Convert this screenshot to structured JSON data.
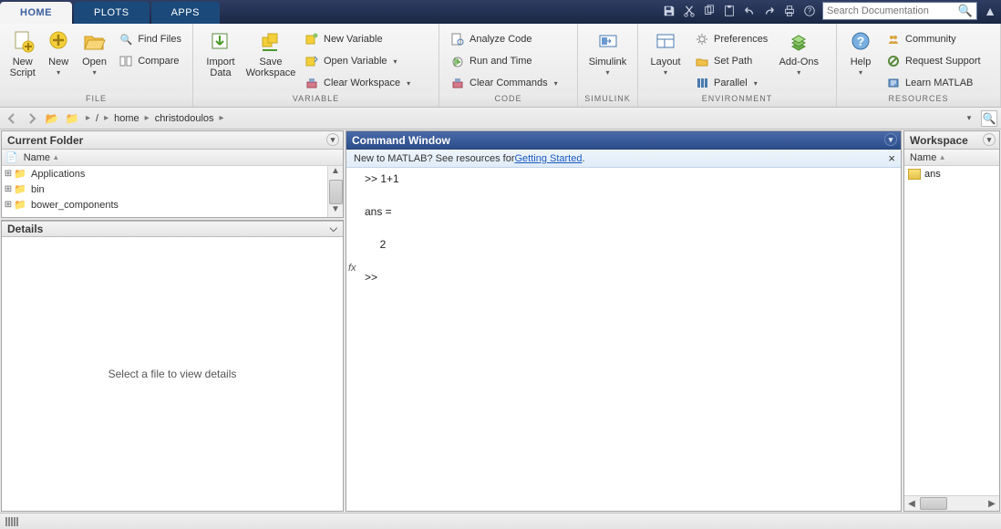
{
  "tabs": {
    "home": "HOME",
    "plots": "PLOTS",
    "apps": "APPS"
  },
  "search": {
    "placeholder": "Search Documentation"
  },
  "toolstrip": {
    "file": {
      "label": "FILE",
      "new_script": "New\nScript",
      "new": "New",
      "open": "Open",
      "find": "Find Files",
      "compare": "Compare"
    },
    "variable": {
      "label": "VARIABLE",
      "import": "Import\nData",
      "save": "Save\nWorkspace",
      "newvar": "New Variable",
      "openvar": "Open Variable",
      "clearws": "Clear Workspace"
    },
    "code": {
      "label": "CODE",
      "analyze": "Analyze Code",
      "run": "Run and Time",
      "clearcmd": "Clear Commands"
    },
    "simulink": {
      "label": "SIMULINK",
      "btn": "Simulink"
    },
    "env": {
      "label": "ENVIRONMENT",
      "layout": "Layout",
      "prefs": "Preferences",
      "setpath": "Set Path",
      "parallel": "Parallel",
      "addons": "Add-Ons"
    },
    "res": {
      "label": "RESOURCES",
      "help": "Help",
      "community": "Community",
      "support": "Request Support",
      "learn": "Learn MATLAB"
    }
  },
  "breadcrumb": {
    "parts": [
      "home",
      "christodoulos"
    ]
  },
  "currentFolder": {
    "title": "Current Folder",
    "nameCol": "Name",
    "files": [
      "Applications",
      "bin",
      "bower_components"
    ]
  },
  "details": {
    "title": "Details",
    "placeholder": "Select a file to view details"
  },
  "cmdwin": {
    "title": "Command Window",
    "bannerPrefix": "New to MATLAB? See resources for ",
    "bannerLink": "Getting Started",
    "content": ">> 1+1\n\nans =\n\n     2\n\n>> "
  },
  "workspace": {
    "title": "Workspace",
    "nameCol": "Name",
    "vars": [
      "ans"
    ]
  }
}
